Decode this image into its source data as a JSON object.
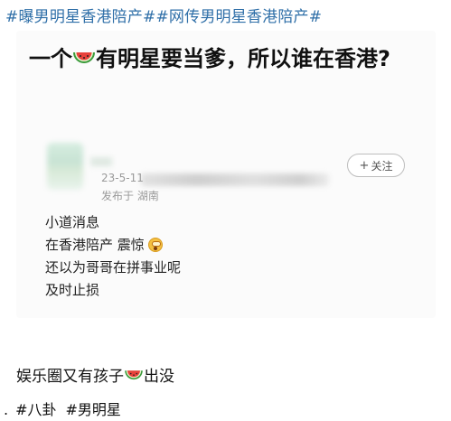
{
  "header": {
    "hashtags": "#曝男明星香港陪产##网传男明星香港陪产#"
  },
  "card": {
    "title_part1": "一个",
    "title_part2": "有明星要当爹，所以谁在香港?"
  },
  "post": {
    "date": "23-5-11",
    "location": "发布于 湖南",
    "follow_label": "关注",
    "follow_plus": "+",
    "lines": [
      "小道消息",
      "在香港陪产 震惊",
      "还以为哥哥在拼事业呢",
      "及时止损"
    ]
  },
  "caption": {
    "text_part1": "娱乐圈又有孩子",
    "text_part2": "出没",
    "dot": ".",
    "tags": [
      "#八卦",
      "#男明星"
    ]
  },
  "icons": {
    "melon": "watermelon-slice-icon",
    "shock": "shocked-face-emoji-icon"
  }
}
